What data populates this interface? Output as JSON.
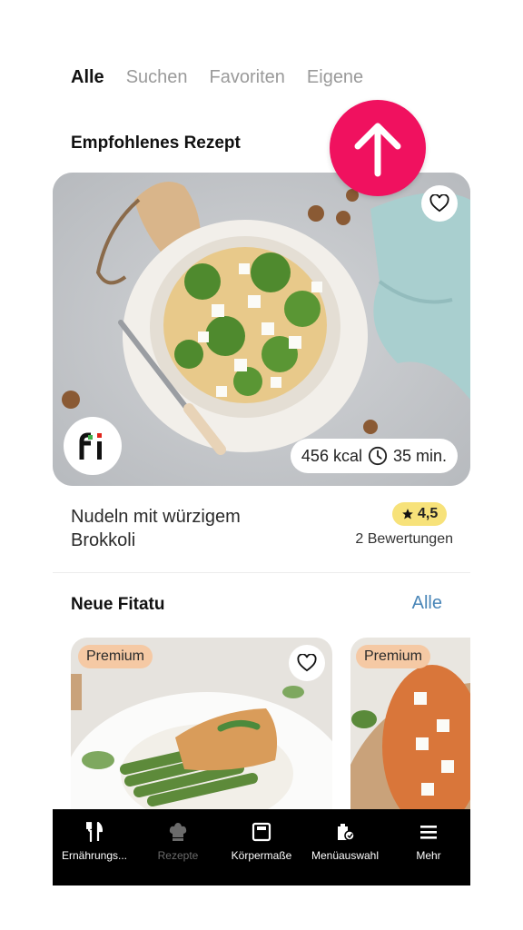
{
  "tabs": [
    {
      "label": "Alle",
      "active": true
    },
    {
      "label": "Suchen",
      "active": false
    },
    {
      "label": "Favoriten",
      "active": false
    },
    {
      "label": "Eigene",
      "active": false
    }
  ],
  "recommended": {
    "section_title": "Empfohlenes Rezept",
    "recipe_name": "Nudeln mit würzigem Brokkoli",
    "kcal": "456 kcal",
    "duration": "35 min.",
    "rating": "4,5",
    "reviews": "2 Bewertungen",
    "logo_text": "fi"
  },
  "new_fitatu": {
    "section_title": "Neue Fitatu",
    "see_all_label": "Alle",
    "cards": [
      {
        "badge": "Premium"
      },
      {
        "badge": "Premium"
      }
    ]
  },
  "bottom_nav": [
    {
      "label": "Ernährungs...",
      "icon": "fork-knife-icon",
      "active": true
    },
    {
      "label": "Rezepte",
      "icon": "chef-hat-icon",
      "active": false
    },
    {
      "label": "Körpermaße",
      "icon": "scale-icon",
      "active": true
    },
    {
      "label": "Menüauswahl",
      "icon": "menu-bag-icon",
      "active": true
    },
    {
      "label": "Mehr",
      "icon": "hamburger-icon",
      "active": true
    }
  ],
  "colors": {
    "accent": "#f0115f",
    "rating_badge": "#f7e27a",
    "premium_badge": "#f5c9a4",
    "link": "#4a86b8",
    "nav_bg": "#000000"
  }
}
